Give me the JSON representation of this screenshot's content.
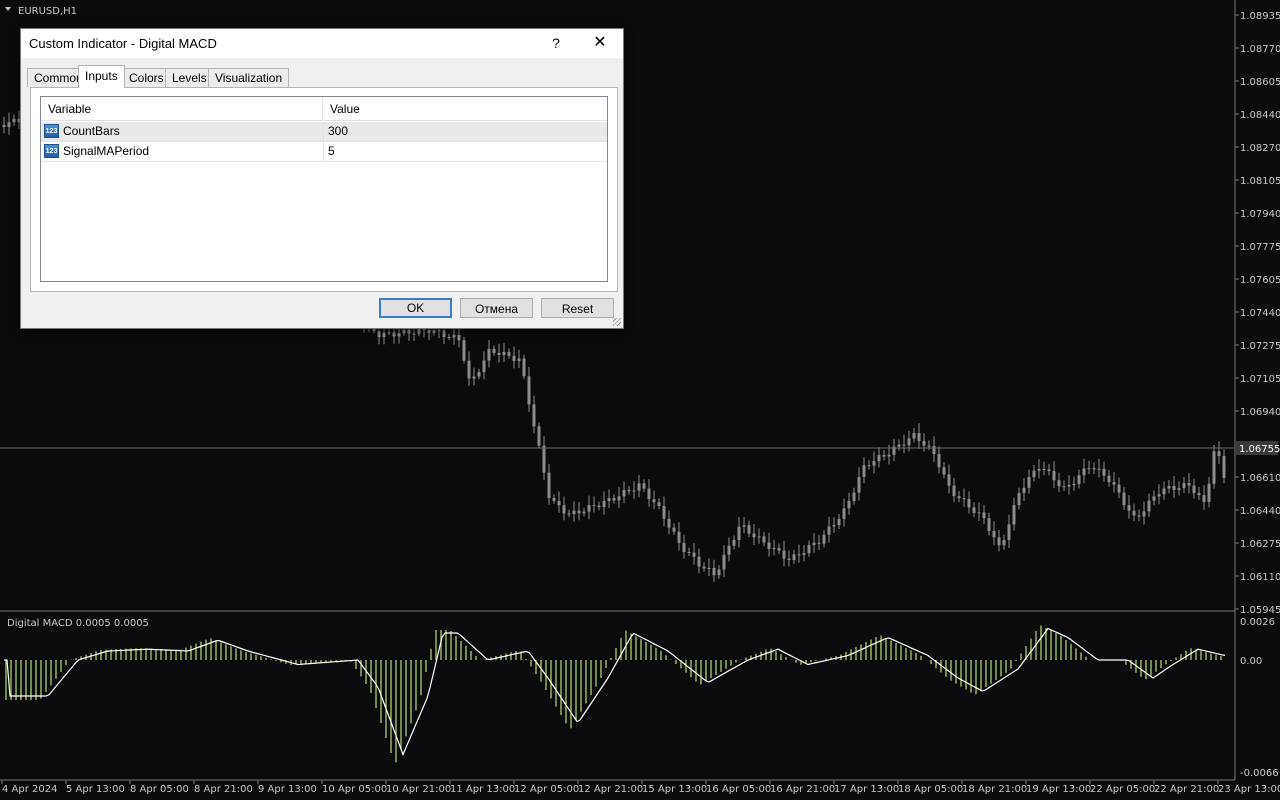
{
  "chart": {
    "symbol_label": "EURUSD,H1",
    "current_price": "1.06755",
    "price_ticks": [
      "1.08935",
      "1.08770",
      "1.08605",
      "1.08440",
      "1.08270",
      "1.08105",
      "1.07940",
      "1.07775",
      "1.07605",
      "1.07440",
      "1.07275",
      "1.07105",
      "1.06940",
      "1.06610",
      "1.06440",
      "1.06275",
      "1.06110",
      "1.05945"
    ],
    "time_ticks": [
      "4 Apr 2024",
      "5 Apr 13:00",
      "8 Apr 05:00",
      "8 Apr 21:00",
      "9 Apr 13:00",
      "10 Apr 05:00",
      "10 Apr 21:00",
      "11 Apr 13:00",
      "12 Apr 05:00",
      "12 Apr 21:00",
      "15 Apr 13:00",
      "16 Apr 05:00",
      "16 Apr 21:00",
      "17 Apr 13:00",
      "18 Apr 05:00",
      "18 Apr 21:00",
      "19 Apr 13:00",
      "22 Apr 05:00",
      "22 Apr 21:00",
      "23 Apr 13:00"
    ],
    "colors": {
      "background": "#0b0b0d",
      "candle": "#8c8c8c",
      "grid_line": "#555555",
      "macd_hist": "#b8e07a",
      "macd_signal": "#ffffff"
    }
  },
  "indicator": {
    "label": "Digital MACD 0.0005 0.0005",
    "ticks": [
      "0.0026",
      "0.00",
      "-0.0066"
    ]
  },
  "dialog": {
    "title": "Custom Indicator - Digital MACD",
    "help_label": "?",
    "close_label": "✕",
    "tabs": [
      "Common",
      "Inputs",
      "Colors",
      "Levels",
      "Visualization"
    ],
    "active_tab": "Inputs",
    "grid": {
      "headers": {
        "variable": "Variable",
        "value": "Value"
      },
      "rows": [
        {
          "icon": "numeric-123-icon",
          "icon_text": "123",
          "variable": "CountBars",
          "value": "300"
        },
        {
          "icon": "numeric-123-icon",
          "icon_text": "123",
          "variable": "SignalMAPeriod",
          "value": "5"
        }
      ]
    },
    "buttons": {
      "ok": "OK",
      "cancel": "Отмена",
      "reset": "Reset"
    }
  }
}
